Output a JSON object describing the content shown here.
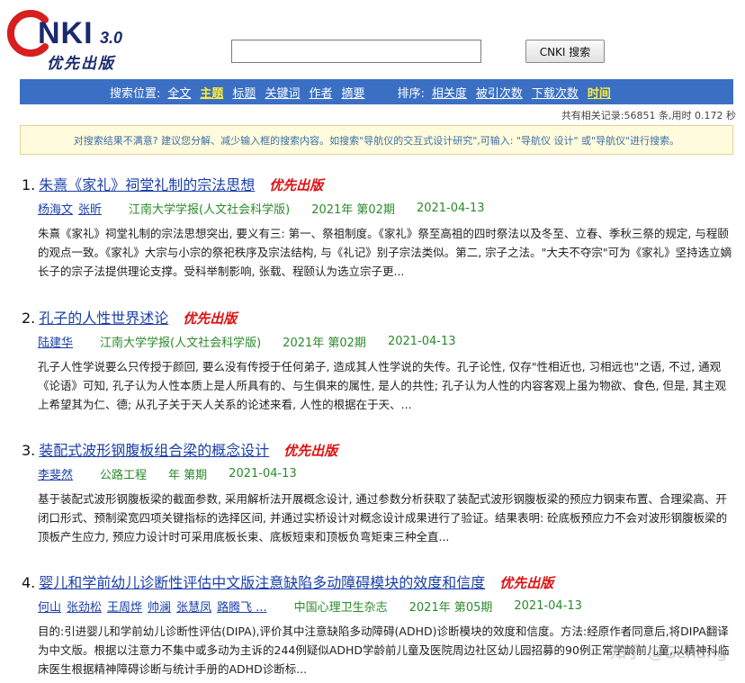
{
  "logo": {
    "brand": "NKI",
    "version": "3.0",
    "subtitle": "优先出版"
  },
  "search": {
    "value": "",
    "placeholder": "",
    "button_label": "CNKI 搜索"
  },
  "navbar": {
    "position_label": "搜索位置:",
    "fields": [
      {
        "label": "全文",
        "active": false
      },
      {
        "label": "主题",
        "active": true
      },
      {
        "label": "标题",
        "active": false
      },
      {
        "label": "关键词",
        "active": false
      },
      {
        "label": "作者",
        "active": false
      },
      {
        "label": "摘要",
        "active": false
      }
    ],
    "sort_label": "排序:",
    "sorts": [
      {
        "label": "相关度",
        "active": false
      },
      {
        "label": "被引次数",
        "active": false
      },
      {
        "label": "下载次数",
        "active": false
      },
      {
        "label": "时间",
        "active": true
      }
    ]
  },
  "stats": "共有相关记录:56851 条,用时 0.172 秒",
  "tip": "对搜索结果不满意? 建议您分解、减少输入框的搜索内容。如搜索\"导航仪的交互式设计研究\",可输入: \"导航仪 设计\" 或\"导航仪\"进行搜索。",
  "results": [
    {
      "num": "1.",
      "title": "朱熹《家礼》祠堂礼制的宗法思想",
      "tag": "优先出版",
      "authors": [
        "杨海文",
        "张昕"
      ],
      "journal": "江南大学学报(人文社会科学版)",
      "issue": "2021年 第02期",
      "date": "2021-04-13",
      "abstract": "朱熹《家礼》祠堂礼制的宗法思想突出, 要义有三: 第一、祭祖制度。《家礼》祭至高祖的四时祭法以及冬至、立春、季秋三祭的规定, 与程颐的观点一致。《家礼》大宗与小宗的祭祀秩序及宗法结构, 与《礼记》别子宗法类似。第二, 宗子之法。\"大夫不夺宗\"可为《家礼》坚持选立嫡长子的宗子法提供理论支撑。受科举制影响, 张载、程颐认为选立宗子更..."
    },
    {
      "num": "2.",
      "title": "孔子的人性世界述论",
      "tag": "优先出版",
      "authors": [
        "陆建华"
      ],
      "journal": "江南大学学报(人文社会科学版)",
      "issue": "2021年 第02期",
      "date": "2021-04-13",
      "abstract": "孔子人性学说要么只传授于颜回, 要么没有传授于任何弟子, 造成其人性学说的失传。孔子论性, 仅存\"性相近也, 习相远也\"之语, 不过, 通观《论语》可知, 孔子认为人性本质上是人所具有的、与生俱来的属性, 是人的共性; 孔子认为人性的内容客观上虽为物欲、食色, 但是, 其主观上希望其为仁、德; 从孔子关于天人关系的论述来看, 人性的根据在于天、..."
    },
    {
      "num": "3.",
      "title": "装配式波形钢腹板组合梁的概念设计",
      "tag": "优先出版",
      "authors": [
        "李斐然"
      ],
      "journal": "公路工程",
      "issue": "年 第期",
      "date": "2021-04-13",
      "abstract": "基于装配式波形钢腹板梁的截面参数, 采用解析法开展概念设计, 通过参数分析获取了装配式波形钢腹板梁的预应力钢束布置、合理梁高、开闭口形式、预制梁宽四项关键指标的选择区间, 并通过实桥设计对概念设计成果进行了验证。结果表明: 砼底板预应力不会对波形钢腹板梁的顶板产生应力, 预应力设计时可采用底板长束、底板短束和顶板负弯矩束三种全直..."
    },
    {
      "num": "4.",
      "title": "婴儿和学前幼儿诊断性评估中文版注意缺陷多动障碍模块的效度和信度",
      "tag": "优先出版",
      "authors": [
        "何山",
        "张劲松",
        "王周烨",
        "帅澜",
        "张慧凤",
        "路腾飞 ..."
      ],
      "journal": "中国心理卫生杂志",
      "issue": "2021年 第05期",
      "date": "2021-04-13",
      "abstract": "目的:引进婴儿和学前幼儿诊断性评估(DIPA),评价其中注意缺陷多动障碍(ADHD)诊断模块的效度和信度。方法:经原作者同意后,将DIPA翻译为中文版。根据以注意力不集中或多动为主诉的244例疑似ADHD学龄前儿童及医院周边社区幼儿园招募的90例正常学龄前儿童,以精神科临床医生根据精神障碍诊断与统计手册的ADHD诊断标..."
    }
  ],
  "watermark": "知乎 @Gehang",
  "colors": {
    "navbar": "#3a6fc4",
    "link": "#1a3fa8",
    "green": "#2a8a2a",
    "tag": "#e01010",
    "active": "#ffee33"
  }
}
